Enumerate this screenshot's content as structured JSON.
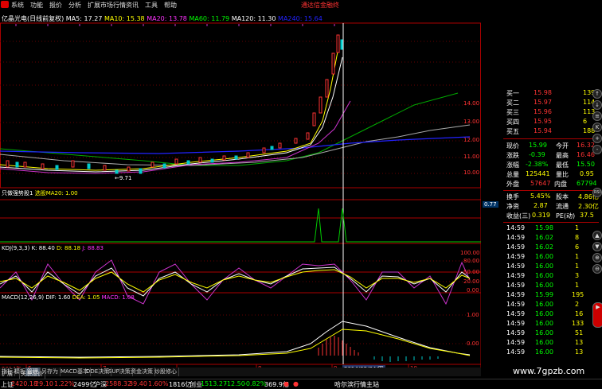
{
  "menu": {
    "items": [
      "系统",
      "功能",
      "报价",
      "分析",
      "扩展市场行情",
      "资讯",
      "工具",
      "帮助"
    ],
    "tagline": "通达信金融终"
  },
  "header": {
    "stock": "亿晶光电(日线前复权)",
    "ma5": "MA5: 17.27",
    "ma10": "MA10: 15.38",
    "ma20": "MA20: 13.78",
    "ma60": "MA60: 11.79",
    "ma120": "MA120: 11.30",
    "ma240": "MA240: 15.64"
  },
  "price_axis": [
    "14.00",
    "13.00",
    "12.00",
    "11.00",
    "10.00"
  ],
  "low_marker": "←9.71",
  "indicator1": {
    "title": "只做强势股1",
    "sub": "选股MA20: 1.00",
    "tick": "0.77"
  },
  "kdj": {
    "title": "KDJ(9,3,3)",
    "k": "K: 88.40",
    "d": "D: 88.18",
    "j": "J: 88.83",
    "ticks": [
      "100.00",
      "80.00",
      "50.00",
      "20.00",
      "0.00"
    ]
  },
  "macd": {
    "title": "MACD(12,26,9)",
    "dif": "DIF: 1.60",
    "dea": "DEA: 1.05",
    "macd": "MACD: 1.08",
    "ticks": [
      "1.00",
      "0.00"
    ]
  },
  "time_axis": {
    "labels": [
      "2014年",
      "6",
      "7",
      "8",
      "9",
      "10"
    ],
    "cursor_date": "2014/09/04/四"
  },
  "orderbook": {
    "asks": [
      {
        "label": "买一",
        "price": "15.98",
        "vol": "139"
      },
      {
        "label": "买二",
        "price": "15.97",
        "vol": "114"
      },
      {
        "label": "买三",
        "price": "15.96",
        "vol": "113"
      },
      {
        "label": "买四",
        "price": "15.95",
        "vol": "6"
      },
      {
        "label": "买五",
        "price": "15.94",
        "vol": "188"
      }
    ]
  },
  "quote": [
    {
      "k1": "现价",
      "v1": "15.99",
      "k2": "今开",
      "v2": "16.32"
    },
    {
      "k1": "涨跌",
      "v1": "-0.39",
      "k2": "最高",
      "v2": "16.46"
    },
    {
      "k1": "涨幅",
      "v1": "-2.38%",
      "k2": "最低",
      "v2": "15.50"
    },
    {
      "k1": "总量",
      "v1": "125441",
      "k2": "量比",
      "v2": "0.95"
    },
    {
      "k1": "外盘",
      "v1": "57647",
      "k2": "内盘",
      "v2": "67794"
    },
    {
      "k1": "换手",
      "v1": "5.45%",
      "k2": "股本",
      "v2": "4.86亿"
    },
    {
      "k1": "净资",
      "v1": "2.87",
      "k2": "流通",
      "v2": "2.30亿"
    },
    {
      "k1": "收益(三)",
      "v1": "0.319",
      "k2": "PE(动)",
      "v2": "37.5"
    }
  ],
  "ticks": [
    {
      "t": "14:59",
      "p": "15.98",
      "v": "1"
    },
    {
      "t": "14:59",
      "p": "16.02",
      "v": "8"
    },
    {
      "t": "14:59",
      "p": "16.02",
      "v": "6"
    },
    {
      "t": "14:59",
      "p": "16.00",
      "v": "1"
    },
    {
      "t": "14:59",
      "p": "16.00",
      "v": "1"
    },
    {
      "t": "14:59",
      "p": "16.00",
      "v": "3"
    },
    {
      "t": "14:59",
      "p": "16.00",
      "v": "1"
    },
    {
      "t": "14:59",
      "p": "15.99",
      "v": "195"
    },
    {
      "t": "14:59",
      "p": "16.00",
      "v": "2"
    },
    {
      "t": "14:59",
      "p": "16.00",
      "v": "16"
    },
    {
      "t": "14:59",
      "p": "16.00",
      "v": "133"
    },
    {
      "t": "14:59",
      "p": "16.00",
      "v": "51"
    },
    {
      "t": "14:59",
      "p": "16.00",
      "v": "13"
    },
    {
      "t": "14:59",
      "p": "16.00",
      "v": "13"
    }
  ],
  "tabs": [
    "指标",
    "模板",
    "管理",
    "另存为",
    "MACD基本",
    "DDE决策",
    "SUP决策",
    "资金决策",
    "炒股修心"
  ],
  "tabs2": [
    "扩展^",
    "关联报价"
  ],
  "status": {
    "sh_label": "上证",
    "sh_val": "2420.18",
    "sh_chg": "29.10",
    "sh_pct": "1.22%",
    "sh_amt": "2499亿",
    "hs_label": "沪深",
    "hs_val": "2588.32",
    "hs_chg": "39.40",
    "hs_pct": "1.60%",
    "hs_amt": "1816亿",
    "cy_label": "创业",
    "cy_val": "1513.27",
    "cy_chg": "-12.50",
    "cy_pct": "-0.82%",
    "cy_amt": "369.9亿",
    "site": "哈尔滨行情主站"
  },
  "watermark": "www.7gpzb.com",
  "side_buttons": [
    "↑",
    "↓",
    "≡",
    "K",
    "+",
    "-",
    "RSI",
    "▲",
    "▼",
    "⊕",
    "⊖",
    "▶"
  ]
}
